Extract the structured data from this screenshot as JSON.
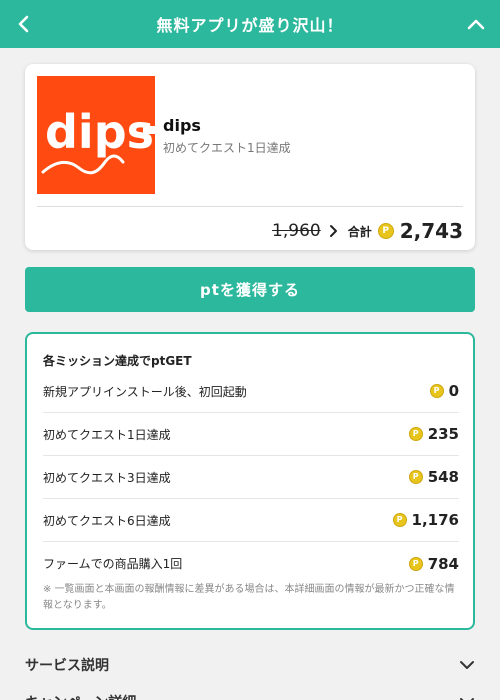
{
  "header": {
    "title": "無料アプリが盛り沢山！",
    "bg_color": "#2cb89c"
  },
  "app": {
    "logo_text": "dips",
    "logo_color": "#ff4a12",
    "name": "dips",
    "subtitle": "初めてクエスト1日達成",
    "old_price": "1,960",
    "total_label": "合計",
    "total_value": "2,743"
  },
  "cta": {
    "label": "ptを獲得する"
  },
  "missions": {
    "heading": "各ミッション達成でptGET",
    "items": [
      {
        "label": "新規アプリインストール後、初回起動",
        "points": "0"
      },
      {
        "label": "初めてクエスト1日達成",
        "points": "235"
      },
      {
        "label": "初めてクエスト3日達成",
        "points": "548"
      },
      {
        "label": "初めてクエスト6日達成",
        "points": "1,176"
      },
      {
        "label": "ファームでの商品購入1回",
        "points": "784"
      }
    ],
    "note": "※ 一覧画面と本画面の報酬情報に差異がある場合は、本詳細画面の情報が最新かつ正確な情報となります。"
  },
  "sections": [
    {
      "label": "サービス説明"
    },
    {
      "label": "キャンペーン詳細"
    }
  ],
  "coin_glyph": "P",
  "icons": [
    "chevron-left-icon",
    "chevron-up-icon",
    "chevron-right-icon",
    "point-coin-icon",
    "chevron-down-icon"
  ]
}
